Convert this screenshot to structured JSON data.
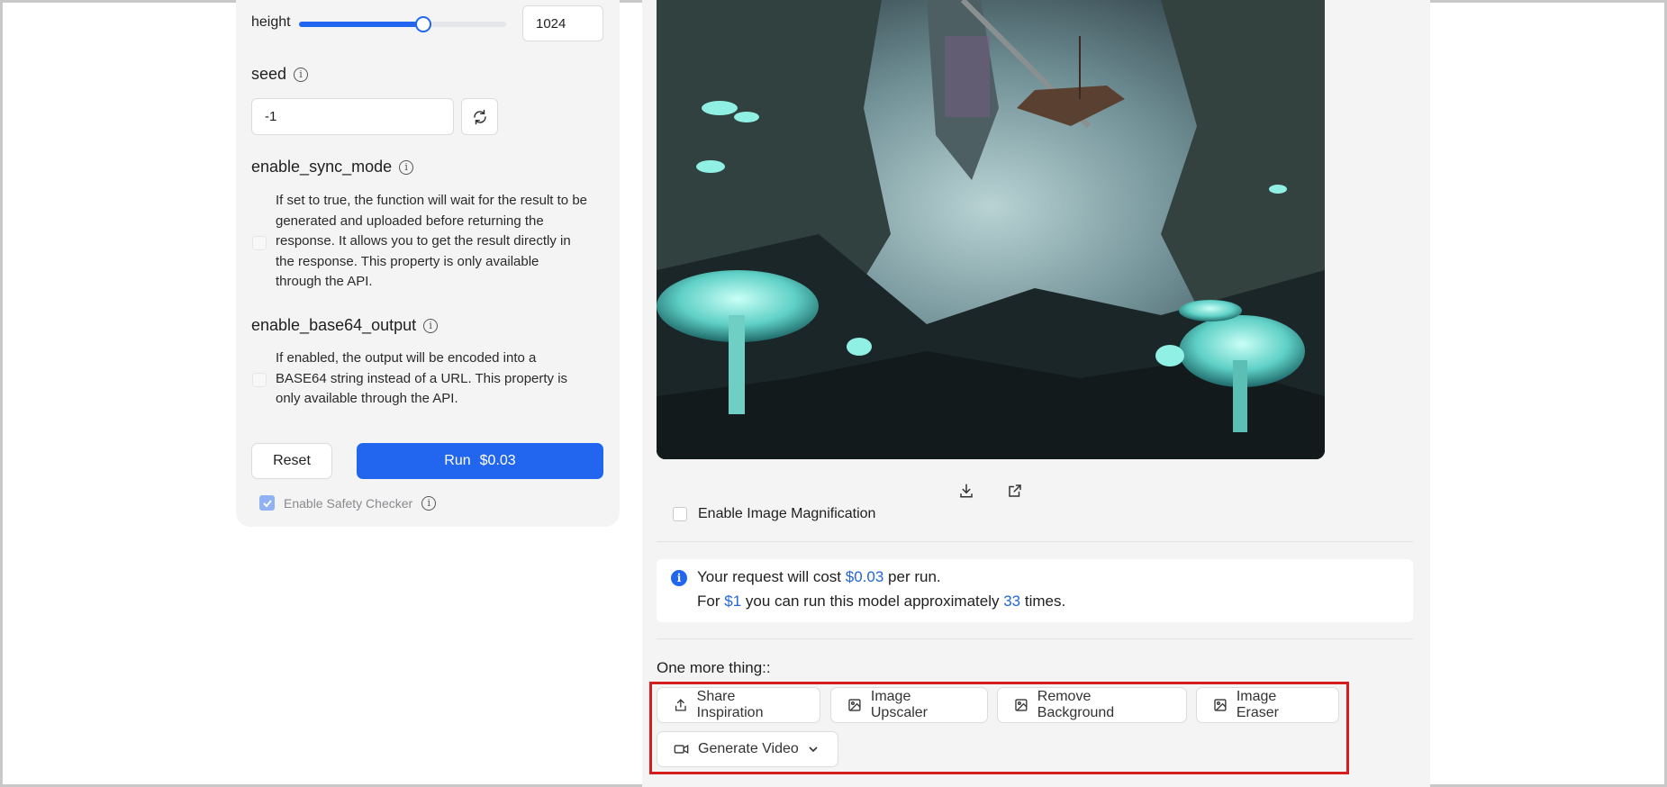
{
  "params": {
    "height": {
      "label": "height",
      "value": "1024",
      "slider_fraction": 0.6
    },
    "seed": {
      "label": "seed",
      "value": "-1"
    },
    "enable_sync_mode": {
      "label": "enable_sync_mode",
      "description": "If set to true, the function will wait for the result to be generated and uploaded before returning the response. It allows you to get the result directly in the response. This property is only available through the API.",
      "lines": [
        "If set to true, the function will wait for the result to be",
        "generated and uploaded before returning the",
        "response. It allows you to get the result directly in",
        "the response. This property is only available",
        "through the API."
      ]
    },
    "enable_base64_output": {
      "label": "enable_base64_output",
      "lines": [
        "If enabled, the output will be encoded into a",
        "BASE64 string instead of a URL. This property is",
        "only available through the API."
      ]
    }
  },
  "actions": {
    "reset_label": "Reset",
    "run_label": "Run",
    "run_price": "$0.03",
    "safety_label": "Enable Safety Checker"
  },
  "output": {
    "magnification_label": "Enable Image Magnification",
    "download_icon": "download-icon",
    "open_icon": "external-link-icon"
  },
  "cost": {
    "line1_prefix": "Your request will cost",
    "line1_price": "$0.03",
    "line1_suffix": "per run.",
    "line2_prefix": "For",
    "line2_amount": "$1",
    "line2_middle": "you can run this model approximately",
    "line2_count": "33",
    "line2_suffix": "times."
  },
  "more": {
    "title": "One more thing::",
    "buttons": [
      {
        "label": "Share Inspiration",
        "icon": "share-icon"
      },
      {
        "label": "Image Upscaler",
        "icon": "image-icon"
      },
      {
        "label": "Remove Background",
        "icon": "image-icon"
      },
      {
        "label": "Image Eraser",
        "icon": "image-icon"
      },
      {
        "label": "Generate Video",
        "icon": "video-icon"
      }
    ]
  },
  "colors": {
    "accent": "#2266f0",
    "highlight": "#d41f1f",
    "panel": "#f4f4f5"
  }
}
